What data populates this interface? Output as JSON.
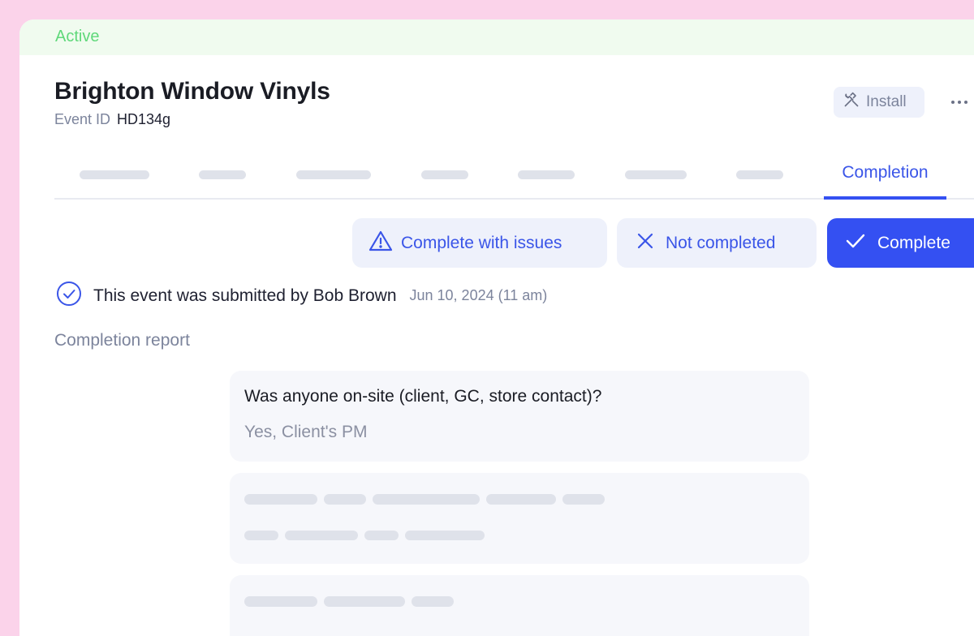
{
  "status": {
    "label": "Active"
  },
  "event": {
    "title": "Brighton Window Vinyls",
    "id_label": "Event ID",
    "id_value": "HD134g"
  },
  "header_actions": {
    "install_label": "Install",
    "install_icon": "hammer-wrench-icon",
    "more_icon": "more-dots-icon"
  },
  "tabs": {
    "active_label": "Completion"
  },
  "actions": {
    "complete_with_issues_label": "Complete with issues",
    "not_completed_label": "Not completed",
    "complete_label": "Complete"
  },
  "submission": {
    "text": "This event was submitted by Bob Brown",
    "date": "Jun 10, 2024 (11 am)"
  },
  "report": {
    "section_label": "Completion report",
    "items": [
      {
        "question": "Was anyone on-site (client, GC, store contact)?",
        "answer": "Yes, Client's PM"
      }
    ]
  },
  "colors": {
    "accent": "#3450f2",
    "active_status": "#5fd87a",
    "background": "#fbd3ea"
  }
}
